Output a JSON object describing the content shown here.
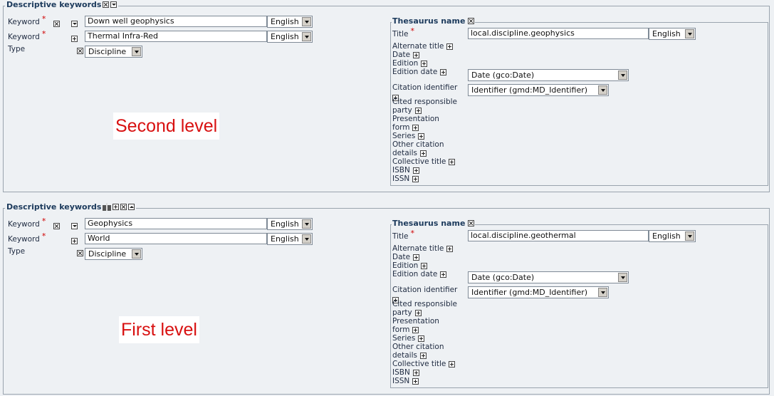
{
  "sections": [
    {
      "legend": "Descriptive keywords",
      "keywords": [
        {
          "label": "Keyword",
          "value": "Down well geophysics",
          "lang": "English"
        },
        {
          "label": "Keyword",
          "value": "Thermal Infra-Red",
          "lang": "English"
        }
      ],
      "type_label": "Type",
      "type_value": "Discipline",
      "thesaurus": {
        "legend": "Thesaurus name",
        "title_label": "Title",
        "title_value": "local.discipline.geophysics",
        "title_lang": "English",
        "alternate_title": "Alternate title",
        "date": "Date",
        "edition": "Edition",
        "edition_date": "Edition date",
        "date_select": "Date (gco:Date)",
        "citation_identifier": "Citation identifier",
        "identifier_select": "Identifier (gmd:MD_Identifier)",
        "cited_party_1": "Cited responsible",
        "cited_party_2": "party",
        "presentation_1": "Presentation",
        "presentation_2": "form",
        "series": "Series",
        "other_citation_1": "Other citation",
        "other_citation_2": "details",
        "collective_title": "Collective title",
        "isbn": "ISBN",
        "issn": "ISSN"
      },
      "annotation": "Second level"
    },
    {
      "legend": "Descriptive keywords",
      "keywords": [
        {
          "label": "Keyword",
          "value": "Geophysics",
          "lang": "English"
        },
        {
          "label": "Keyword",
          "value": "World",
          "lang": "English"
        }
      ],
      "type_label": "Type",
      "type_value": "Discipline",
      "thesaurus": {
        "legend": "Thesaurus name",
        "title_label": "Title",
        "title_value": "local.discipline.geothermal",
        "title_lang": "English",
        "alternate_title": "Alternate title",
        "date": "Date",
        "edition": "Edition",
        "edition_date": "Edition date",
        "date_select": "Date (gco:Date)",
        "citation_identifier": "Citation identifier",
        "identifier_select": "Identifier (gmd:MD_Identifier)",
        "cited_party_1": "Cited responsible",
        "cited_party_2": "party",
        "presentation_1": "Presentation",
        "presentation_2": "form",
        "series": "Series",
        "other_citation_1": "Other citation",
        "other_citation_2": "details",
        "collective_title": "Collective title",
        "isbn": "ISBN",
        "issn": "ISSN"
      },
      "annotation": "First level"
    }
  ],
  "required_mark": "*"
}
